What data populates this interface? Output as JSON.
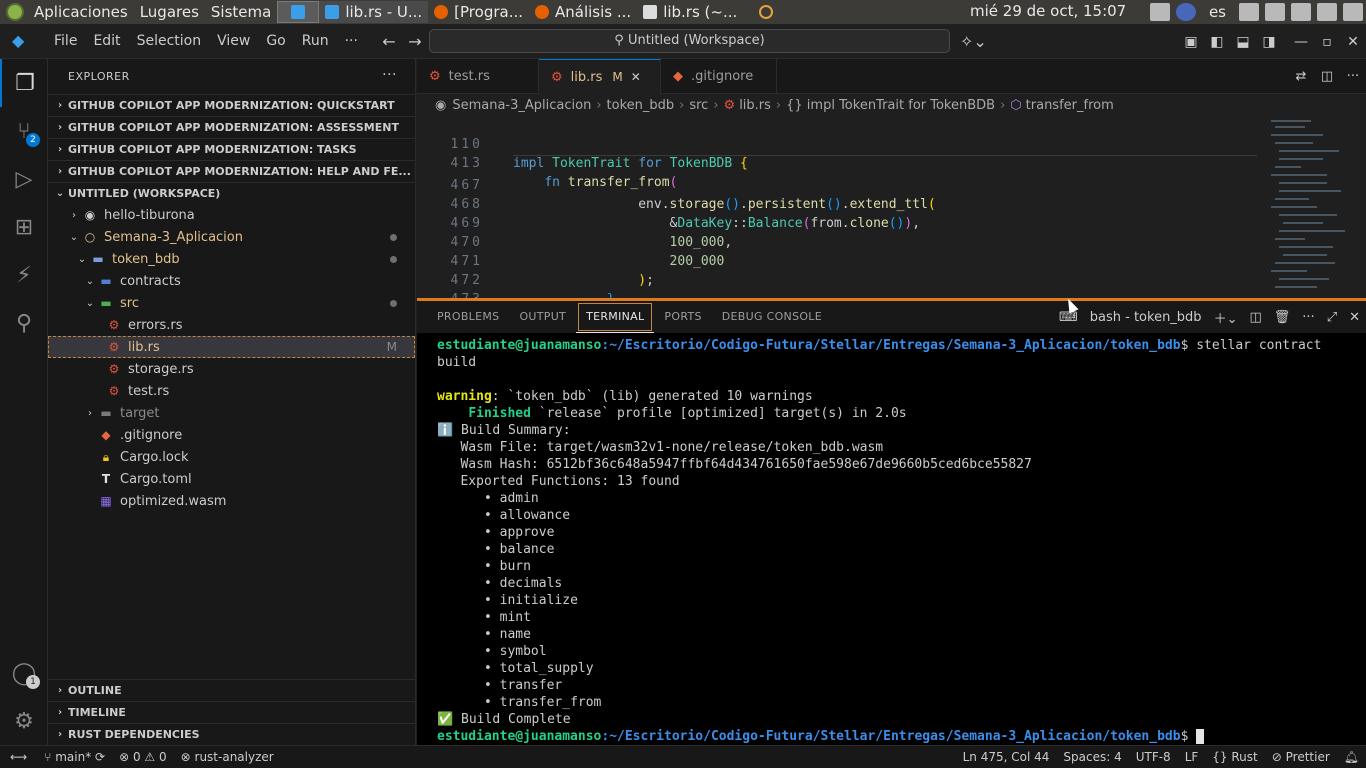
{
  "os_panel": {
    "apps": "Aplicaciones",
    "places": "Lugares",
    "system": "Sistema",
    "tasks": [
      {
        "label": "",
        "color": "#3b9ee8"
      },
      {
        "label": "lib.rs - U...",
        "color": "#3b9ee8"
      },
      {
        "label": "[Progra...",
        "color": "#e66000"
      },
      {
        "label": "Análisis ...",
        "color": "#e66000"
      },
      {
        "label": "lib.rs (~...",
        "color": "#dddddd"
      }
    ],
    "clock": "mié 29 de oct, 15:07",
    "lang": "es"
  },
  "titlebar": {
    "menus": [
      "File",
      "Edit",
      "Selection",
      "View",
      "Go",
      "Run",
      "···"
    ],
    "search": "Untitled (Workspace)"
  },
  "activity": {
    "scm_badge": "2",
    "accounts_badge": "1"
  },
  "sidebar": {
    "title": "EXPLORER",
    "sections_top": [
      "GITHUB COPILOT APP MODERNIZATION: QUICKSTART",
      "GITHUB COPILOT APP MODERNIZATION: ASSESSMENT",
      "GITHUB COPILOT APP MODERNIZATION: TASKS",
      "GITHUB COPILOT APP MODERNIZATION: HELP AND FE..."
    ],
    "workspace": "UNTITLED (WORKSPACE)",
    "tree": [
      {
        "label": "hello-tiburona",
        "depth": 1,
        "chev": "›",
        "icon": "circle-icon"
      },
      {
        "label": "Semana-3_Aplicacion",
        "depth": 1,
        "chev": "⌄",
        "icon": "circle-icon",
        "modified": true
      },
      {
        "label": "token_bdb",
        "depth": 2,
        "chev": "⌄",
        "icon": "folder-icon",
        "modified": true
      },
      {
        "label": "contracts",
        "depth": 3,
        "chev": "⌄",
        "icon": "folder-icon"
      },
      {
        "label": "src",
        "depth": 3,
        "chev": "⌄",
        "icon": "folder-icon",
        "modified": true
      },
      {
        "label": "errors.rs",
        "depth": 4,
        "chev": "",
        "icon": "rust-icon"
      },
      {
        "label": "lib.rs",
        "depth": 4,
        "chev": "",
        "icon": "rust-icon",
        "mark": "M",
        "selected": true
      },
      {
        "label": "storage.rs",
        "depth": 4,
        "chev": "",
        "icon": "rust-icon"
      },
      {
        "label": "test.rs",
        "depth": 4,
        "chev": "",
        "icon": "rust-icon"
      },
      {
        "label": "target",
        "depth": 3,
        "chev": "›",
        "icon": "folder-icon",
        "dim": true
      },
      {
        "label": ".gitignore",
        "depth": 3,
        "chev": "",
        "icon": "git-icon"
      },
      {
        "label": "Cargo.lock",
        "depth": 3,
        "chev": "",
        "icon": "lock-icon"
      },
      {
        "label": "Cargo.toml",
        "depth": 3,
        "chev": "",
        "icon": "toml-icon"
      },
      {
        "label": "optimized.wasm",
        "depth": 3,
        "chev": "",
        "icon": "wasm-icon"
      }
    ],
    "sections_bottom": [
      "OUTLINE",
      "TIMELINE",
      "RUST DEPENDENCIES"
    ]
  },
  "tabs": [
    {
      "label": "test.rs",
      "active": false
    },
    {
      "label": "lib.rs",
      "active": true,
      "mod": "M"
    },
    {
      "label": ".gitignore",
      "active": false
    }
  ],
  "breadcrumb": [
    "Semana-3_Aplicacion",
    "token_bdb",
    "src",
    "lib.rs",
    "{} impl TokenTrait for TokenBDB",
    "transfer_from"
  ],
  "code": {
    "sticky": [
      {
        "num": "110",
        "text": "impl TokenTrait for TokenBDB {"
      },
      {
        "num": "413",
        "text": "    fn transfer_from("
      }
    ],
    "lines": [
      {
        "num": "467",
        "text": "                env.storage().persistent().extend_ttl("
      },
      {
        "num": "468",
        "text": "                    &DataKey::Balance(from.clone()),"
      },
      {
        "num": "469",
        "text": "                    100_000,"
      },
      {
        "num": "470",
        "text": "                    200_000"
      },
      {
        "num": "471",
        "text": "                );"
      },
      {
        "num": "472",
        "text": "            }"
      },
      {
        "num": "473",
        "text": ""
      }
    ]
  },
  "panel": {
    "tabs": [
      "PROBLEMS",
      "OUTPUT",
      "TERMINAL",
      "PORTS",
      "DEBUG CONSOLE"
    ],
    "active_tab": "TERMINAL",
    "terminal_name": "bash - token_bdb"
  },
  "terminal": {
    "prompt_user": "estudiante@juanamanso",
    "prompt_path": ":~/Escritorio/Codigo-Futura/Stellar/Entregas/Semana-3_Aplicacion/token_bdb",
    "cmd1": "$ stellar contract",
    "cmd1_cont": "build",
    "warning_label": "warning",
    "warning_text": ": `token_bdb` (lib) generated 10 warnings",
    "finished_label": "Finished",
    "finished_text": " `release` profile [optimized] target(s) in 2.0s",
    "summary": "ℹ️ Build Summary:",
    "wasm_file": "   Wasm File: target/wasm32v1-none/release/token_bdb.wasm",
    "wasm_hash": "   Wasm Hash: 6512bf36c648a5947ffbf64d434761650fae598e67de9660b5ced6bce55827",
    "exported": "   Exported Functions: 13 found",
    "functions": [
      "admin",
      "allowance",
      "approve",
      "balance",
      "burn",
      "decimals",
      "initialize",
      "mint",
      "name",
      "symbol",
      "total_supply",
      "transfer",
      "transfer_from"
    ],
    "complete": "✅ Build Complete"
  },
  "statusbar": {
    "branch": "main*",
    "errors": "0",
    "warnings": "0",
    "analyzer": "rust-analyzer",
    "position": "Ln 475, Col 44",
    "spaces": "Spaces: 4",
    "encoding": "UTF-8",
    "eol": "LF",
    "language": "Rust",
    "prettier": "Prettier"
  }
}
